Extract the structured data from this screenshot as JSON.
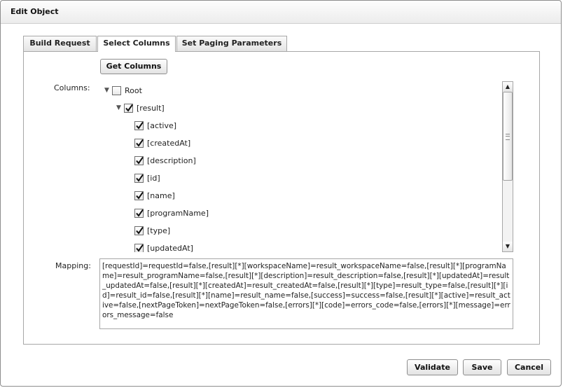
{
  "dialog": {
    "title": "Edit Object"
  },
  "tabs": [
    {
      "label": "Build Request"
    },
    {
      "label": "Select Columns"
    },
    {
      "label": "Set Paging Parameters"
    }
  ],
  "get_columns_label": "Get Columns",
  "columns_label": "Columns:",
  "mapping_label": "Mapping:",
  "tree": [
    {
      "label": "Root",
      "checked": false,
      "expandable": true
    },
    {
      "label": "[result]",
      "checked": true,
      "expandable": true
    },
    {
      "label": "[active]",
      "checked": true
    },
    {
      "label": "[createdAt]",
      "checked": true
    },
    {
      "label": "[description]",
      "checked": true
    },
    {
      "label": "[id]",
      "checked": true
    },
    {
      "label": "[name]",
      "checked": true
    },
    {
      "label": "[programName]",
      "checked": true
    },
    {
      "label": "[type]",
      "checked": true
    },
    {
      "label": "[updatedAt]",
      "checked": true
    }
  ],
  "mapping_value": "[requestId]=requestId=false,[result][*][workspaceName]=result_workspaceName=false,[result][*][programName]=result_programName=false,[result][*][description]=result_description=false,[result][*][updatedAt]=result_updatedAt=false,[result][*][createdAt]=result_createdAt=false,[result][*][type]=result_type=false,[result][*][id]=result_id=false,[result][*][name]=result_name=false,[success]=success=false,[result][*][active]=result_active=false,[nextPageToken]=nextPageToken=false,[errors][*][code]=errors_code=false,[errors][*][message]=errors_message=false",
  "footer": {
    "validate_label": "Validate",
    "save_label": "Save",
    "cancel_label": "Cancel"
  },
  "icons": {
    "expander": "triangle-down-icon",
    "checkmark": "checkmark-icon",
    "scroll_up": "arrow-up-icon",
    "scroll_down": "arrow-down-icon"
  }
}
